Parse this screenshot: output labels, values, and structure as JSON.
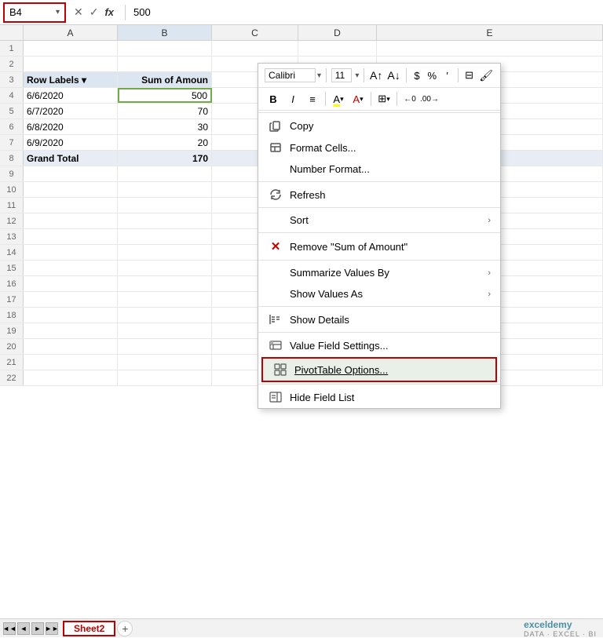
{
  "nameBox": {
    "value": "B4",
    "chevron": "▾"
  },
  "formulaBar": {
    "crossIcon": "✕",
    "checkIcon": "✓",
    "fxLabel": "fx",
    "value": "500"
  },
  "columns": [
    "A",
    "B",
    "C",
    "D",
    "E"
  ],
  "rows": [
    {
      "num": 1,
      "a": "",
      "b": ""
    },
    {
      "num": 2,
      "a": "",
      "b": ""
    },
    {
      "num": 3,
      "a": "Row Labels ▾",
      "b": "Sum of Amount",
      "bold": true
    },
    {
      "num": 4,
      "a": "6/6/2020",
      "b": "500",
      "selected": true
    },
    {
      "num": 5,
      "a": "6/7/2020",
      "b": "70"
    },
    {
      "num": 6,
      "a": "6/8/2020",
      "b": "30"
    },
    {
      "num": 7,
      "a": "6/9/2020",
      "b": "20"
    },
    {
      "num": 8,
      "a": "Grand Total",
      "b": "170",
      "grandTotal": true
    },
    {
      "num": 9,
      "a": "",
      "b": ""
    },
    {
      "num": 10,
      "a": "",
      "b": ""
    },
    {
      "num": 11,
      "a": "",
      "b": ""
    },
    {
      "num": 12,
      "a": "",
      "b": ""
    },
    {
      "num": 13,
      "a": "",
      "b": ""
    },
    {
      "num": 14,
      "a": "",
      "b": ""
    },
    {
      "num": 15,
      "a": "",
      "b": ""
    },
    {
      "num": 16,
      "a": "",
      "b": ""
    },
    {
      "num": 17,
      "a": "",
      "b": ""
    },
    {
      "num": 18,
      "a": "",
      "b": ""
    },
    {
      "num": 19,
      "a": "",
      "b": ""
    },
    {
      "num": 20,
      "a": "",
      "b": ""
    },
    {
      "num": 21,
      "a": "",
      "b": ""
    },
    {
      "num": 22,
      "a": "",
      "b": ""
    }
  ],
  "miniToolbar": {
    "fontName": "Calibri",
    "fontSize": "11",
    "boldLabel": "B",
    "italicLabel": "I",
    "alignLabel": "≡",
    "highlightLabel": "A",
    "fontColorLabel": "A",
    "borderLabel": "⊞",
    "increaseDecLabel": "⇐0",
    "mergeLabel": "⊡",
    "row2": [
      "$",
      "·",
      "%",
      "′",
      "⊟"
    ]
  },
  "contextMenu": {
    "items": [
      {
        "id": "copy",
        "icon": "copy",
        "label": "Copy",
        "hasArrow": false
      },
      {
        "id": "format-cells",
        "icon": "format",
        "label": "Format Cells...",
        "hasArrow": false
      },
      {
        "id": "number-format",
        "icon": "",
        "label": "Number Format...",
        "hasArrow": false
      },
      {
        "id": "separator1"
      },
      {
        "id": "refresh",
        "icon": "refresh",
        "label": "Refresh",
        "hasArrow": false
      },
      {
        "id": "separator2"
      },
      {
        "id": "sort",
        "icon": "",
        "label": "Sort",
        "hasArrow": true
      },
      {
        "id": "separator3"
      },
      {
        "id": "remove",
        "icon": "x",
        "label": "Remove \"Sum of Amount\"",
        "hasArrow": false,
        "isRemove": true
      },
      {
        "id": "separator4"
      },
      {
        "id": "summarize",
        "icon": "",
        "label": "Summarize Values By",
        "hasArrow": true
      },
      {
        "id": "show-values",
        "icon": "",
        "label": "Show Values As",
        "hasArrow": true
      },
      {
        "id": "separator5"
      },
      {
        "id": "show-details",
        "icon": "details",
        "label": "Show Details",
        "hasArrow": false
      },
      {
        "id": "separator6"
      },
      {
        "id": "value-field",
        "icon": "vfield",
        "label": "Value Field Settings...",
        "hasArrow": false
      },
      {
        "id": "pivottable",
        "icon": "",
        "label": "PivotTable Options...",
        "hasArrow": false,
        "isPivot": true
      },
      {
        "id": "separator7"
      },
      {
        "id": "hide-field",
        "icon": "hfield",
        "label": "Hide Field List",
        "hasArrow": false
      }
    ]
  },
  "tabs": {
    "navBtns": [
      "◄◄",
      "◄",
      "►",
      "►►"
    ],
    "sheets": [
      {
        "name": "Sheet2",
        "active": true
      }
    ],
    "addLabel": "+"
  },
  "logo": "exceldemy\nDATA · EXCEL · BI"
}
